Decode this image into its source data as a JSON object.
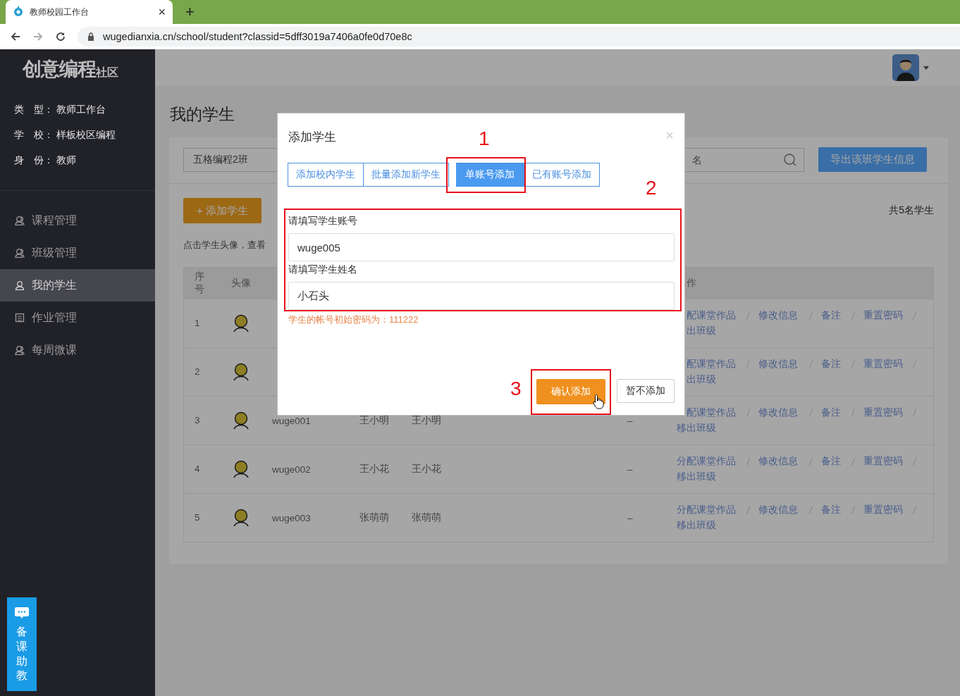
{
  "browser": {
    "tab_title": "教师校园工作台",
    "close": "×",
    "new_tab": "+",
    "url": "wugedianxia.cn/school/student?classid=5dff3019a7406a0fe0d70e8c"
  },
  "sidebar": {
    "logo": "创意编程",
    "logo_suffix": "社区",
    "info": [
      {
        "label": "类　型：",
        "value": "教师工作台"
      },
      {
        "label": "学　校：",
        "value": "样板校区编程"
      },
      {
        "label": "身　份：",
        "value": "教师"
      }
    ],
    "menu": [
      {
        "label": "课程管理",
        "selected": false
      },
      {
        "label": "班级管理",
        "selected": false
      },
      {
        "label": "我的学生",
        "selected": true
      },
      {
        "label": "作业管理",
        "selected": false
      },
      {
        "label": "每周微课",
        "selected": false
      }
    ],
    "helper": {
      "label": "备课助教"
    }
  },
  "page": {
    "title": "我的学生",
    "class_select": "五格编程2班",
    "search_placeholder": "名",
    "export_button": "导出该班学生信息",
    "add_button": "+ 添加学生",
    "count": "共5名学生",
    "hint": "点击学生头像，查看"
  },
  "table": {
    "columns": {
      "index": "序号",
      "avatar": "头像",
      "actions": "作",
      "actions_clipped": true
    },
    "rows": [
      {
        "index": "1",
        "assign": "配课堂作品",
        "assign_clipped": true,
        "edit": "修改信息",
        "note": "备注",
        "reset": "重置密码",
        "remove": "出班级",
        "remove_clipped": true
      },
      {
        "index": "2",
        "assign": "配课堂作品",
        "assign_clipped": true,
        "edit": "修改信息",
        "note": "备注",
        "reset": "重置密码",
        "remove": "出班级",
        "remove_clipped": true
      },
      {
        "index": "3",
        "account": "wuge001",
        "name": "王小明",
        "nickname": "王小明",
        "dash": "–",
        "assign": "配课堂作品",
        "assign_clipped": true,
        "edit": "修改信息",
        "note": "备注",
        "reset": "重置密码",
        "remove": "移出班级"
      },
      {
        "index": "4",
        "account": "wuge002",
        "name": "王小花",
        "nickname": "王小花",
        "dash": "–",
        "assign": "分配课堂作品",
        "assign_clipped": false,
        "edit": "修改信息",
        "note": "备注",
        "reset": "重置密码",
        "remove": "移出班级"
      },
      {
        "index": "5",
        "account": "wuge003",
        "name": "张萌萌",
        "nickname": "张萌萌",
        "dash": "–",
        "assign": "分配课堂作品",
        "assign_clipped": false,
        "edit": "修改信息",
        "note": "备注",
        "reset": "重置密码",
        "remove": "移出班级"
      }
    ]
  },
  "dialog": {
    "title": "添加学生",
    "close": "×",
    "tabs": [
      {
        "label": "添加校内学生",
        "selected": false
      },
      {
        "label": "批量添加新学生",
        "selected": false
      },
      {
        "label": "单账号添加",
        "selected": true
      },
      {
        "label": "已有账号添加",
        "selected": false
      }
    ],
    "fields": [
      {
        "label": "请填写学生账号",
        "value": "wuge005"
      },
      {
        "label": "请填写学生姓名",
        "value": "小石头"
      }
    ],
    "note": "学生的帐号初始密码为：111222",
    "confirm": "确认添加",
    "cancel": "暂不添加"
  },
  "annotations": [
    {
      "label": "1"
    },
    {
      "label": "2"
    },
    {
      "label": "3"
    }
  ]
}
